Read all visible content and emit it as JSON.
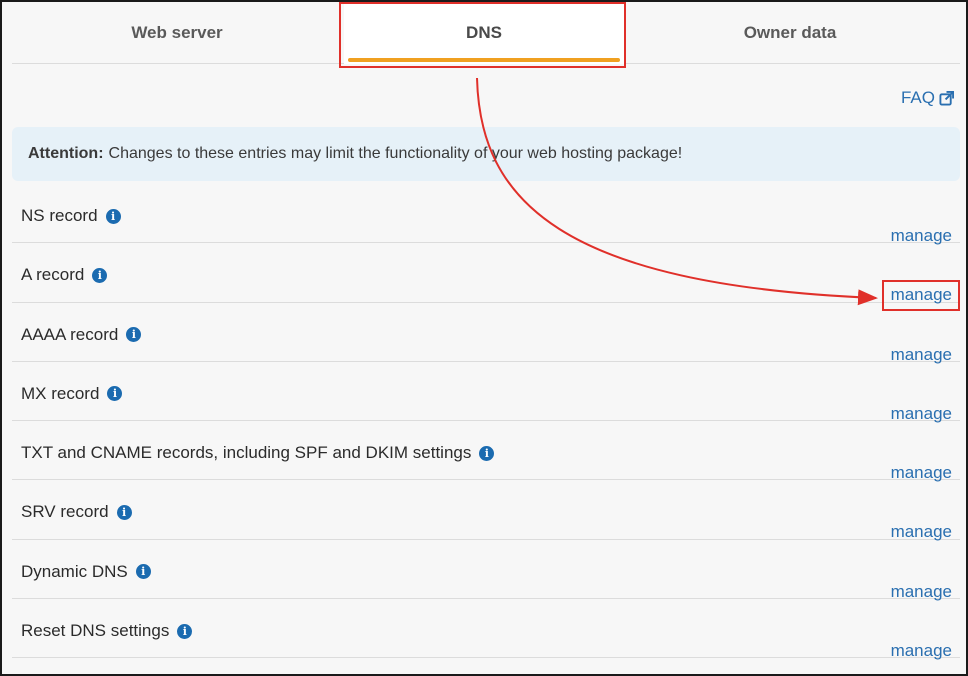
{
  "tabs": [
    {
      "label": "Web server"
    },
    {
      "label": "DNS"
    },
    {
      "label": "Owner data"
    }
  ],
  "faq": {
    "label": "FAQ",
    "icon": "external-link-icon"
  },
  "alert": {
    "title": "Attention:",
    "message": "Changes to these entries may limit the functionality of your web hosting package!"
  },
  "records": [
    {
      "label": "NS record",
      "action": "manage"
    },
    {
      "label": "A record",
      "action": "manage"
    },
    {
      "label": "AAAA record",
      "action": "manage"
    },
    {
      "label": "MX record",
      "action": "manage"
    },
    {
      "label": "TXT and CNAME records, including SPF and DKIM settings",
      "action": "manage"
    },
    {
      "label": "SRV record",
      "action": "manage"
    },
    {
      "label": "Dynamic DNS",
      "action": "manage"
    },
    {
      "label": "Reset DNS settings",
      "action": "manage"
    }
  ],
  "colors": {
    "accent": "#f0a020",
    "link": "#2a6fb0",
    "annotation": "#e0302a",
    "info": "#1b6bb0"
  }
}
